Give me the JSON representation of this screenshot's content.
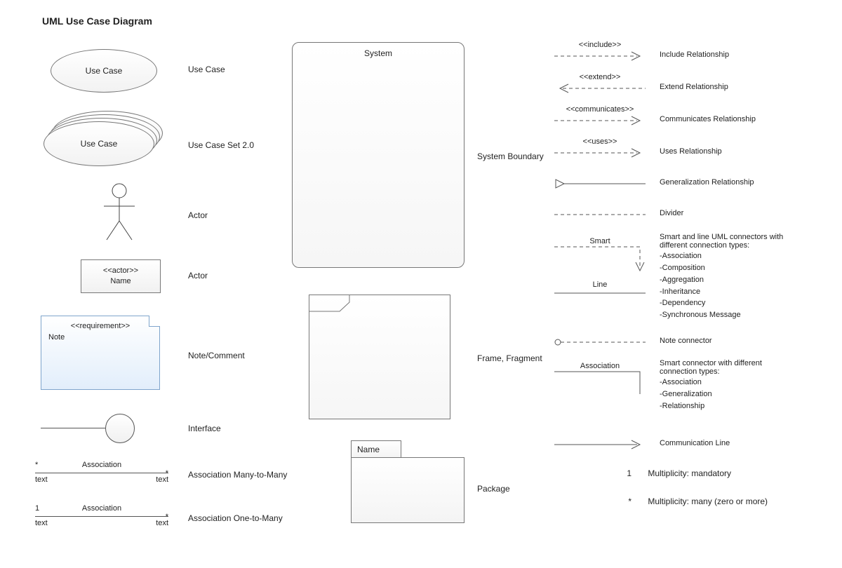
{
  "title": "UML Use Case Diagram",
  "col1": {
    "usecase": {
      "shape_text": "Use Case",
      "label": "Use Case"
    },
    "usecase_set": {
      "shape_text": "Use Case",
      "label": "Use Case Set 2.0"
    },
    "actor_stick": {
      "label": "Actor"
    },
    "actor_box": {
      "stereo": "<<actor>>",
      "name": "Name",
      "label": "Actor"
    },
    "note": {
      "stereo": "<<requirement>>",
      "body": "Note",
      "label": "Note/Comment"
    },
    "interface": {
      "label": "Interface"
    },
    "assoc_mm": {
      "over_left": "*",
      "over_right": "*",
      "over_center": "Association",
      "under_left": "text",
      "under_right": "text",
      "label": "Association Many-to-Many"
    },
    "assoc_om": {
      "over_left": "1",
      "over_right": "*",
      "over_center": "Association",
      "under_left": "text",
      "under_right": "text",
      "label": "Association One-to-Many"
    }
  },
  "col2": {
    "system": {
      "title": "System",
      "label": "System Boundary"
    },
    "frame": {
      "label": "Frame, Fragment"
    },
    "package": {
      "name": "Name",
      "label": "Package"
    }
  },
  "col3": {
    "include": {
      "cap": "<<include>>",
      "label": "Include Relationship"
    },
    "extend": {
      "cap": "<<extend>>",
      "label": "Extend Relationship"
    },
    "comm": {
      "cap": "<<communicates>>",
      "label": "Communicates Relationship"
    },
    "uses": {
      "cap": "<<uses>>",
      "label": "Uses Relationship"
    },
    "general": {
      "cap": "",
      "label": "Generalization Relationship"
    },
    "divider": {
      "cap": "",
      "label": "Divider"
    },
    "smart": {
      "cap": "Smart",
      "label": "Smart and line UML connectors with different connection types:",
      "bullets": [
        "-Association",
        "-Composition",
        "-Aggregation",
        "-Inheritance",
        "-Dependency",
        "-Synchronous Message"
      ]
    },
    "line": {
      "cap": "Line"
    },
    "noteconn": {
      "cap": "",
      "label": "Note connector"
    },
    "assoc": {
      "cap": "Association",
      "label": "Smart connector with different connection types:",
      "bullets": [
        "-Association",
        "-Generalization",
        "-Relationship"
      ]
    },
    "commline": {
      "cap": "",
      "label": "Communication Line"
    },
    "mult1": {
      "sym": "1",
      "label": "Multiplicity: mandatory"
    },
    "multstar": {
      "sym": "*",
      "label": "Multiplicity: many (zero or more)"
    }
  }
}
